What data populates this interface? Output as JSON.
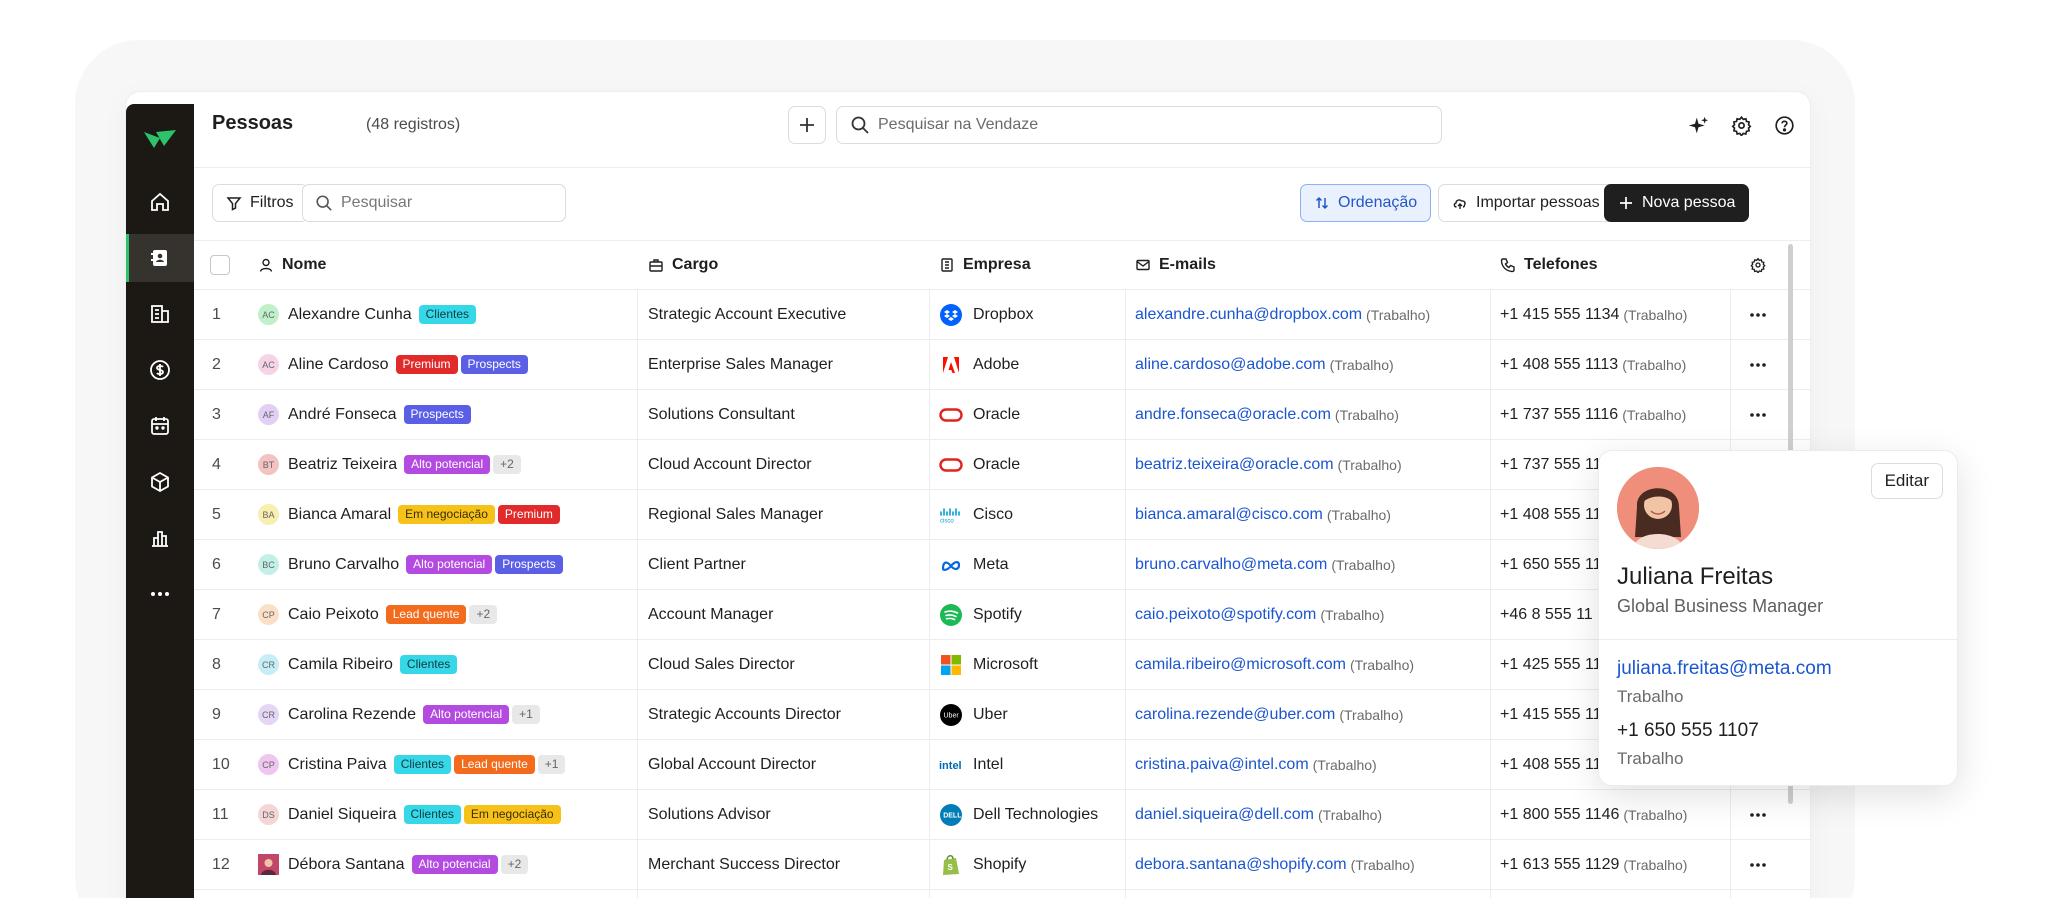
{
  "header": {
    "title": "Pessoas",
    "count": "(48 registros)",
    "search_placeholder": "Pesquisar na Vendaze"
  },
  "toolbar": {
    "filters_label": "Filtros",
    "search_placeholder": "Pesquisar",
    "sort_label": "Ordenação",
    "import_label": "Importar pessoas",
    "new_label": "Nova pessoa"
  },
  "columns": {
    "name": "Nome",
    "cargo": "Cargo",
    "company": "Empresa",
    "emails": "E-mails",
    "phones": "Telefones"
  },
  "tag_colors": {
    "Clientes": [
      "#36d8e8",
      "#0d3b40"
    ],
    "Premium": [
      "#e12b2b",
      "#ffffff"
    ],
    "Prospects": [
      "#5b5fe6",
      "#ffffff"
    ],
    "Alto potencial": [
      "#b44be0",
      "#ffffff"
    ],
    "Em negociação": [
      "#f6c21a",
      "#3a2d00"
    ],
    "Lead quente": [
      "#f36b1c",
      "#ffffff"
    ],
    "more": [
      "#e8e8e8",
      "#666666"
    ]
  },
  "rows": [
    {
      "num": "1",
      "initials": "AC",
      "avatar_color": "#bff0c9",
      "name": "Alexandre Cunha",
      "tags": [
        "Clientes"
      ],
      "more": "",
      "cargo": "Strategic Account Executive",
      "company": "Dropbox",
      "logo": "dropbox-icon",
      "email": "alexandre.cunha@dropbox.com",
      "email_type": "(Trabalho)",
      "phone": "+1 415 555 1134",
      "phone_type": "(Trabalho)"
    },
    {
      "num": "2",
      "initials": "AC",
      "avatar_color": "#f6d4e8",
      "name": "Aline Cardoso",
      "tags": [
        "Premium",
        "Prospects"
      ],
      "more": "",
      "cargo": "Enterprise Sales Manager",
      "company": "Adobe",
      "logo": "adobe-icon",
      "email": "aline.cardoso@adobe.com",
      "email_type": "(Trabalho)",
      "phone": "+1 408 555 1113",
      "phone_type": "(Trabalho)"
    },
    {
      "num": "3",
      "initials": "AF",
      "avatar_color": "#e2cff5",
      "name": "André Fonseca",
      "tags": [
        "Prospects"
      ],
      "more": "",
      "cargo": "Solutions Consultant",
      "company": "Oracle",
      "logo": "oracle-icon",
      "email": "andre.fonseca@oracle.com",
      "email_type": "(Trabalho)",
      "phone": "+1 737 555 1116",
      "phone_type": "(Trabalho)"
    },
    {
      "num": "4",
      "initials": "BT",
      "avatar_color": "#f2c3c0",
      "name": "Beatriz Teixeira",
      "tags": [
        "Alto potencial"
      ],
      "more": "+2",
      "cargo": "Cloud Account Director",
      "company": "Oracle",
      "logo": "oracle-icon",
      "email": "beatriz.teixeira@oracle.com",
      "email_type": "(Trabalho)",
      "phone": "+1 737 555 11",
      "phone_type": ""
    },
    {
      "num": "5",
      "initials": "BA",
      "avatar_color": "#f7eeb0",
      "name": "Bianca Amaral",
      "tags": [
        "Em negociação",
        "Premium"
      ],
      "more": "",
      "cargo": "Regional Sales Manager",
      "company": "Cisco",
      "logo": "cisco-icon",
      "email": "bianca.amaral@cisco.com",
      "email_type": "(Trabalho)",
      "phone": "+1 408 555 11",
      "phone_type": ""
    },
    {
      "num": "6",
      "initials": "BC",
      "avatar_color": "#c2f0e8",
      "name": "Bruno Carvalho",
      "tags": [
        "Alto potencial",
        "Prospects"
      ],
      "more": "",
      "cargo": "Client Partner",
      "company": "Meta",
      "logo": "meta-icon",
      "email": "bruno.carvalho@meta.com",
      "email_type": "(Trabalho)",
      "phone": "+1 650 555 11",
      "phone_type": ""
    },
    {
      "num": "7",
      "initials": "CP",
      "avatar_color": "#fbe0c8",
      "name": "Caio Peixoto",
      "tags": [
        "Lead quente"
      ],
      "more": "+2",
      "cargo": "Account Manager",
      "company": "Spotify",
      "logo": "spotify-icon",
      "email": "caio.peixoto@spotify.com",
      "email_type": "(Trabalho)",
      "phone": "+46 8 555 11",
      "phone_type": ""
    },
    {
      "num": "8",
      "initials": "CR",
      "avatar_color": "#c6eef7",
      "name": "Camila Ribeiro",
      "tags": [
        "Clientes"
      ],
      "more": "",
      "cargo": "Cloud Sales Director",
      "company": "Microsoft",
      "logo": "microsoft-icon",
      "email": "camila.ribeiro@microsoft.com",
      "email_type": "(Trabalho)",
      "phone": "+1 425 555 11",
      "phone_type": ""
    },
    {
      "num": "9",
      "initials": "CR",
      "avatar_color": "#e6d6f5",
      "name": "Carolina Rezende",
      "tags": [
        "Alto potencial"
      ],
      "more": "+1",
      "cargo": "Strategic Accounts Director",
      "company": "Uber",
      "logo": "uber-icon",
      "email": "carolina.rezende@uber.com",
      "email_type": "(Trabalho)",
      "phone": "+1 415 555 11",
      "phone_type": ""
    },
    {
      "num": "10",
      "initials": "CP",
      "avatar_color": "#efc6f0",
      "name": "Cristina Paiva",
      "tags": [
        "Clientes",
        "Lead quente"
      ],
      "more": "+1",
      "cargo": "Global Account Director",
      "company": "Intel",
      "logo": "intel-icon",
      "email": "cristina.paiva@intel.com",
      "email_type": "(Trabalho)",
      "phone": "+1 408 555 11",
      "phone_type": ""
    },
    {
      "num": "11",
      "initials": "DS",
      "avatar_color": "#f4d6d6",
      "name": "Daniel Siqueira",
      "tags": [
        "Clientes",
        "Em negociação"
      ],
      "more": "",
      "cargo": "Solutions Advisor",
      "company": "Dell Technologies",
      "logo": "dell-icon",
      "email": "daniel.siqueira@dell.com",
      "email_type": "(Trabalho)",
      "phone": "+1 800 555 1146",
      "phone_type": "(Trabalho)"
    },
    {
      "num": "12",
      "initials": "",
      "avatar_color": "#c2466a",
      "name": "Débora Santana",
      "tags": [
        "Alto potencial"
      ],
      "more": "+2",
      "cargo": "Merchant Success Director",
      "company": "Shopify",
      "logo": "shopify-icon",
      "email": "debora.santana@shopify.com",
      "email_type": "(Trabalho)",
      "phone": "+1 613 555 1129",
      "phone_type": "(Trabalho)"
    }
  ],
  "popover": {
    "edit_label": "Editar",
    "name": "Juliana Freitas",
    "role": "Global Business Manager",
    "email": "juliana.freitas@meta.com",
    "email_type": "Trabalho",
    "phone": "+1 650 555 1107",
    "phone_type": "Trabalho"
  },
  "colors": {
    "sidebar": "#1c1915",
    "brand_green": "#2cc36b",
    "link_blue": "#1b55d0",
    "sort_bg": "#eaf1fe"
  }
}
